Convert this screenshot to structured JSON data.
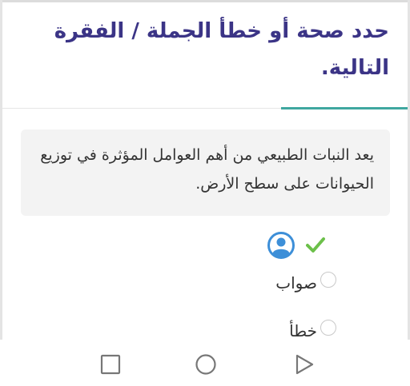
{
  "question": {
    "title": "حدد صحة أو خطأ الجملة / الفقرة التالية.",
    "statement": "يعد النبات الطبيعي من أهم العوامل المؤثرة في توزيع الحيوانات على سطح الأرض."
  },
  "answer_status": {
    "user_icon": "user-avatar-icon",
    "check_icon": "checkmark-icon",
    "correct_color": "#6cc04a",
    "user_color": "#3d8fd8"
  },
  "options": [
    {
      "label": "صواب",
      "selected": false
    },
    {
      "label": "خطأ",
      "selected": false
    }
  ],
  "nav": {
    "icons": [
      "square-icon",
      "circle-icon",
      "triangle-icon"
    ]
  },
  "colors": {
    "title": "#3b3486",
    "accent": "#3fa7a0",
    "card_bg": "#f3f3f3"
  }
}
